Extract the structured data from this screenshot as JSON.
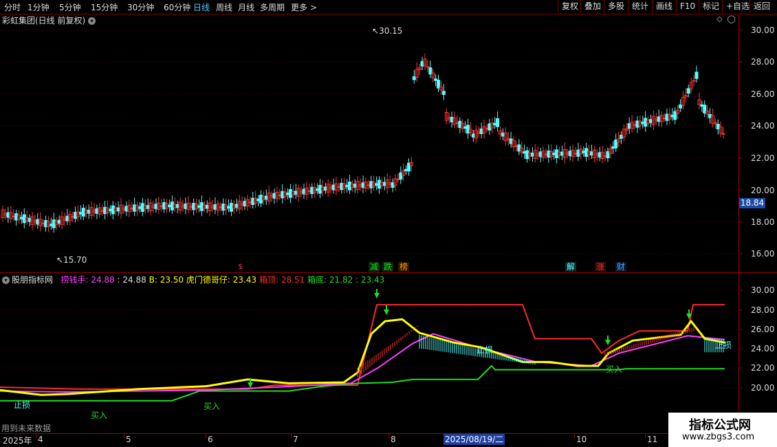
{
  "toolbar": {
    "periods": [
      "分时",
      "1分钟",
      "5分钟",
      "15分钟",
      "30分钟",
      "60分钟",
      "日线",
      "周线",
      "月线",
      "多周期"
    ],
    "active_period": "日线",
    "more_label": "更多 >",
    "right_buttons": [
      "复权",
      "叠加",
      "多股",
      "统计",
      "画线",
      "F10",
      "标记",
      "+自选",
      "返回"
    ]
  },
  "main_chart": {
    "title": "彩虹集团(日线 前复权)",
    "high_marker": "30.15",
    "low_marker": "15.70",
    "current_price_tag": "18.84",
    "price_axis": [
      "30.00",
      "28.00",
      "26.00",
      "24.00",
      "22.00",
      "20.00",
      "18.00",
      "16.00"
    ],
    "event_badges": [
      "减",
      "跌",
      "榜",
      "解",
      "涨",
      "财"
    ],
    "small_marker": "$"
  },
  "indicator": {
    "name": "股朋指标网",
    "items": [
      {
        "label": "捞钱手:",
        "value": "24.88",
        "color": "#ff40ff"
      },
      {
        "label": ":",
        "value": "24.88",
        "color": "#ddd"
      },
      {
        "label": "B:",
        "value": "23.50",
        "color": "#ffff00"
      },
      {
        "label": "虎门德哥仔:",
        "value": "23.43",
        "color": "#ffff00"
      },
      {
        "label": "箱顶:",
        "value": "28.51",
        "color": "#ff2a2a"
      },
      {
        "label": "箱底:",
        "value": "21.82",
        "color": "#22dd22"
      },
      {
        "label": ":",
        "value": "23.43",
        "color": "#22dd22"
      }
    ],
    "axis": [
      "30.00",
      "28.00",
      "26.00",
      "24.00",
      "22.00",
      "20.00"
    ],
    "chart_texts": [
      "买入",
      "买入",
      "买入",
      "止损",
      "止损",
      "止损"
    ],
    "future_note": "用到未来数据"
  },
  "date_axis": {
    "labels": [
      "2025年",
      "4",
      "5",
      "6",
      "7",
      "8",
      "9",
      "10",
      "11"
    ],
    "selected_date": "2025/08/19/二"
  },
  "watermark": {
    "line1": "指标公式网",
    "line2": "www.zbgs3.com"
  },
  "colors": {
    "up": "#ff3333",
    "down": "#54ffff",
    "grid": "#7a0000",
    "yellow": "#ffff00",
    "magenta": "#ff40ff",
    "green": "#22dd22"
  }
}
